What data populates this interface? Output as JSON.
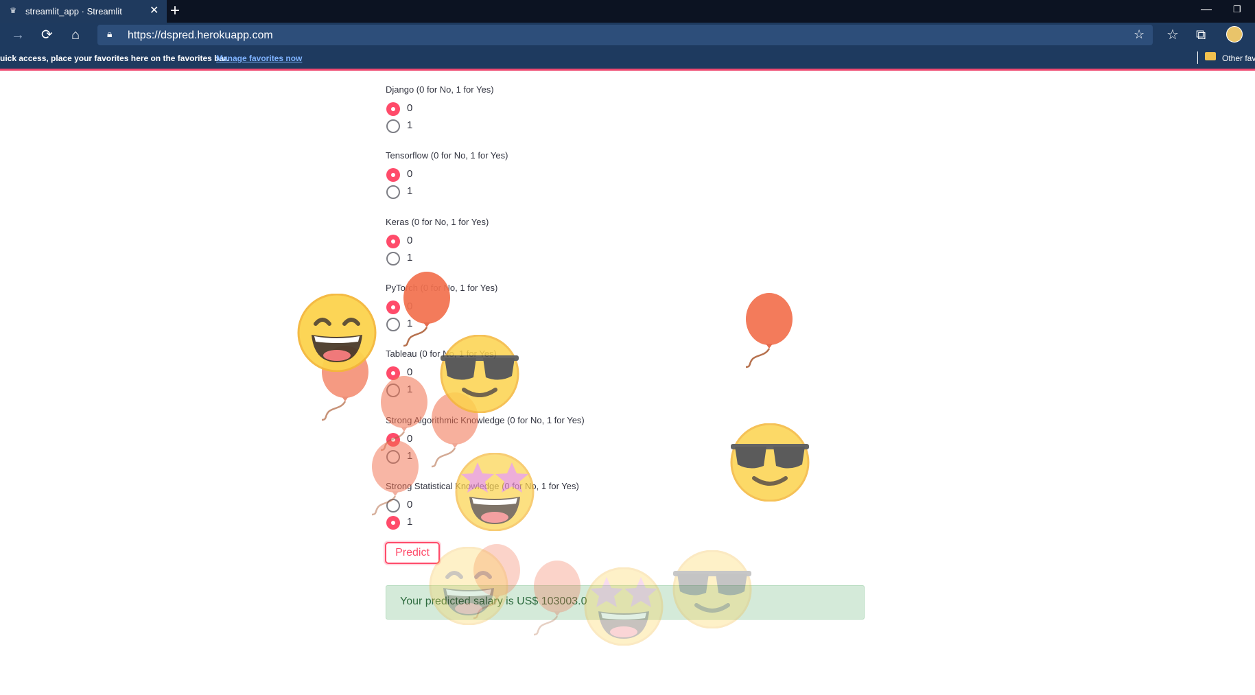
{
  "browser": {
    "tab_title": "streamlit_app · Streamlit",
    "tab_close": "✕",
    "new_tab": "+",
    "url": "https://dspred.herokuapp.com",
    "favorites_message": "uick access, place your favorites here on the favorites bar.",
    "favorites_link": "Manage favorites now",
    "other_favorites": "Other fav",
    "window_min": "—",
    "window_restore": "❐"
  },
  "questions": [
    {
      "label": "Django (0 for No, 1 for Yes)",
      "options": [
        "0",
        "1"
      ],
      "selected": "0"
    },
    {
      "label": "Tensorflow (0 for No, 1 for Yes)",
      "options": [
        "0",
        "1"
      ],
      "selected": "0"
    },
    {
      "label": "Keras (0 for No, 1 for Yes)",
      "options": [
        "0",
        "1"
      ],
      "selected": "0"
    },
    {
      "label": "PyTorch (0 for No, 1 for Yes)",
      "options": [
        "0",
        "1"
      ],
      "selected": "0"
    },
    {
      "label": "Tableau (0 for No, 1 for Yes)",
      "options": [
        "0",
        "1"
      ],
      "selected": "0"
    },
    {
      "label": "Strong Algorithmic Knowledge (0 for No, 1 for Yes)",
      "options": [
        "0",
        "1"
      ],
      "selected": "0"
    },
    {
      "label": "Strong Statistical Knowledge (0 for No, 1 for Yes)",
      "options": [
        "0",
        "1"
      ],
      "selected": "1"
    }
  ],
  "predict_button": "Predict",
  "result": "Your predicted salary is US$ 103003.0",
  "colors": {
    "accent": "#ff4b6a",
    "success_bg": "#d4ead9",
    "success_text": "#2e6b3f",
    "balloon": "#f2704e",
    "emoji": "#fcd34d"
  },
  "icons": [
    "streamlit-crown-icon",
    "close-icon",
    "plus-icon",
    "forward-icon",
    "refresh-icon",
    "home-icon",
    "lock-icon",
    "add-favorite-icon",
    "favorites-icon",
    "collections-icon",
    "profile-avatar",
    "folder-icon",
    "balloon-icon",
    "grinning-emoji-icon",
    "sunglasses-emoji-icon",
    "star-struck-emoji-icon"
  ]
}
